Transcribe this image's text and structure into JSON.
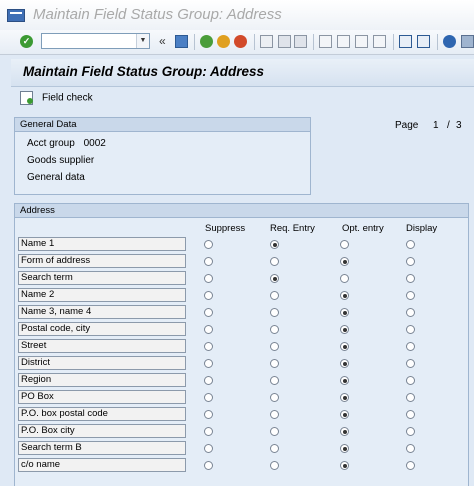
{
  "window": {
    "title": "Maintain Field Status Group: Address"
  },
  "toolbar": {
    "command_field_value": "",
    "icons": [
      "enter-icon",
      "back-icon",
      "save-icon",
      "back-arrows-icon",
      "exit-icon",
      "cancel-icon",
      "print-icon",
      "find-icon",
      "find-next-icon",
      "first-page-icon",
      "previous-page-icon",
      "next-page-icon",
      "last-page-icon",
      "new-session-icon",
      "shortcut-icon",
      "help-icon",
      "customize-icon"
    ]
  },
  "header": {
    "title": "Maintain Field Status Group: Address"
  },
  "actions": {
    "field_check_label": "Field check"
  },
  "general_data": {
    "title": "General Data",
    "acct_group_label": "Acct group",
    "acct_group_value": "0002",
    "line2": "Goods supplier",
    "line3": "General data"
  },
  "pagination": {
    "label": "Page",
    "current": "1",
    "separator": "/",
    "total": "3"
  },
  "address": {
    "title": "Address",
    "columns": [
      "Suppress",
      "Req. Entry",
      "Opt. entry",
      "Display"
    ],
    "rows": [
      {
        "label": "Name 1",
        "selected": 1
      },
      {
        "label": "Form of address",
        "selected": 2
      },
      {
        "label": "Search term",
        "selected": 1
      },
      {
        "label": "Name 2",
        "selected": 2
      },
      {
        "label": "Name 3, name 4",
        "selected": 2
      },
      {
        "label": "Postal code, city",
        "selected": 2
      },
      {
        "label": "Street",
        "selected": 2
      },
      {
        "label": "District",
        "selected": 2
      },
      {
        "label": "Region",
        "selected": 2
      },
      {
        "label": "PO Box",
        "selected": 2
      },
      {
        "label": "P.O. box postal code",
        "selected": 2
      },
      {
        "label": "P.O. Box city",
        "selected": 2
      },
      {
        "label": "Search term B",
        "selected": 2
      },
      {
        "label": "c/o name",
        "selected": 2
      }
    ]
  },
  "colors": {
    "accent": "#3f6fb5",
    "panel": "#e4edf7",
    "panel_header": "#c9d8ea"
  }
}
